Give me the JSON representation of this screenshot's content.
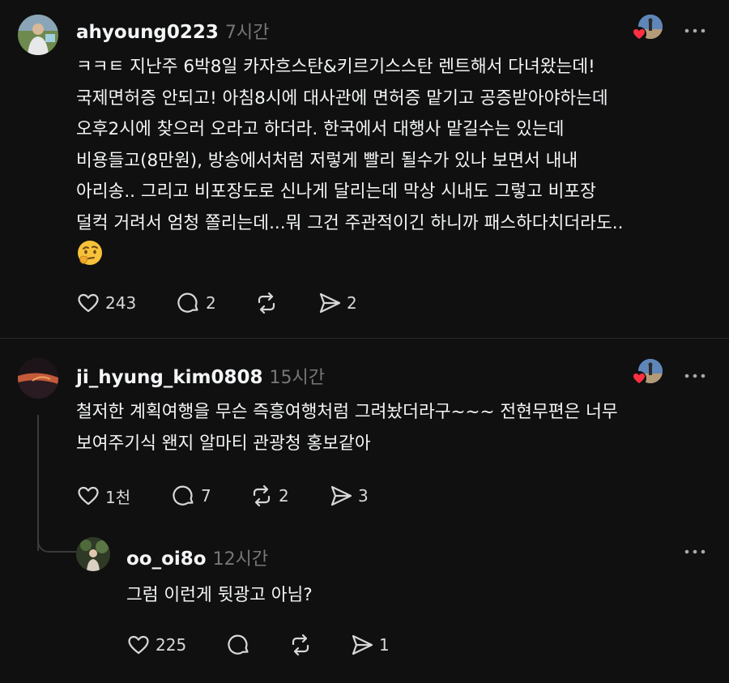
{
  "posts": [
    {
      "username": "ahyoung0223",
      "time": "7시간",
      "lines": [
        "ㅋㅋㅌ  지난주 6박8일 카자흐스탄&키르기스스탄 렌트해서 다녀왔는데!",
        "국제면허증 안되고! 아침8시에 대사관에 면허증 맡기고 공증받아야하는데",
        "오후2시에 찾으러 오라고 하더라. 한국에서 대행사 맡길수는 있는데",
        "비용들고(8만원), 방송에서처럼 저렇게 빨리 될수가 있나 보면서 내내",
        "아리송.. 그리고 비포장도로 신나게 달리는데 막상 시내도 그렇고 비포장",
        "덜컥 거려서 엄청 쫄리는데...뭐 그건 주관적이긴 하니까 패스하다치더라도.."
      ],
      "emoji": "🤔",
      "likes": "243",
      "comments": "2",
      "reposts": "",
      "shares": "2"
    },
    {
      "username": "ji_hyung_kim0808",
      "time": "15시간",
      "lines": [
        "철저한 계획여행을 무슨 즉흥여행처럼 그려놨더라구~~~ 전현무편은 너무",
        "보여주기식 왠지 알마티 관광청 홍보같아"
      ],
      "likes": "1천",
      "comments": "7",
      "reposts": "2",
      "shares": "3"
    },
    {
      "username": "oo_oi8o",
      "time": "12시간",
      "lines": [
        "그럼 이런게 뒷광고 아님?"
      ],
      "likes": "225",
      "comments": "",
      "reposts": "",
      "shares": "1"
    }
  ],
  "icons": {
    "like": "heart-icon",
    "comment": "comment-bubble-icon",
    "repost": "repost-icon",
    "share": "send-icon",
    "more": "more-dots-icon",
    "liked_badge": "red-heart-icon"
  },
  "colors": {
    "background": "#101010",
    "text": "#f3f5f7",
    "muted": "#777777",
    "heart": "#ff3040"
  }
}
